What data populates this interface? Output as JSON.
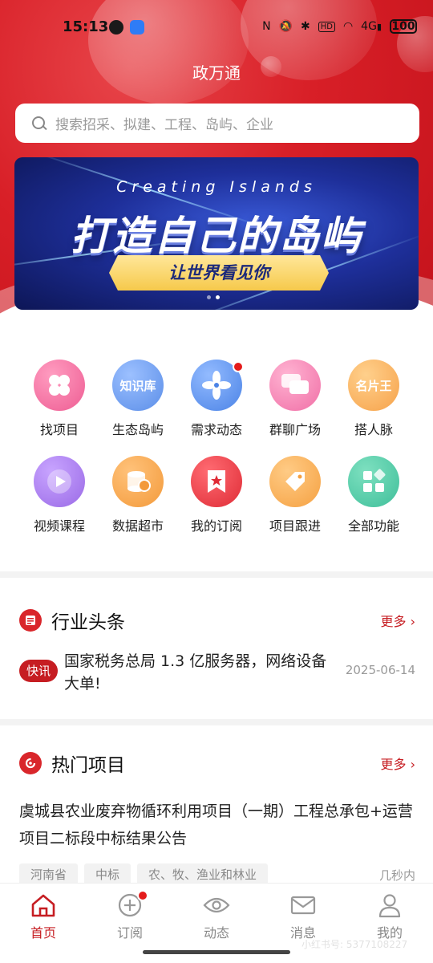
{
  "status_bar": {
    "time": "15:13",
    "network": "4G",
    "battery": "100",
    "icons": [
      "nfc-icon",
      "mute-icon",
      "bluetooth-icon",
      "hd-icon",
      "wifi-icon",
      "signal-icon"
    ]
  },
  "app": {
    "title": "政万通"
  },
  "search": {
    "placeholder": "搜索招采、拟建、工程、岛屿、企业"
  },
  "banner": {
    "subtitle": "Creating Islands",
    "headline": "打造自己的岛屿",
    "ribbon": "让世界看见你",
    "page_count": 2,
    "active_page": 2
  },
  "grid": [
    {
      "label": "找项目",
      "icon": "clover-icon",
      "color": "#ee5d93"
    },
    {
      "label": "生态岛屿",
      "icon": "knowledge-base-icon",
      "icon_text": "知识库",
      "color": "#5b8ee8"
    },
    {
      "label": "需求动态",
      "icon": "fan-icon",
      "color": "#4b83e6",
      "badge": true
    },
    {
      "label": "群聊广场",
      "icon": "chat-bubbles-icon",
      "color": "#f06fa6"
    },
    {
      "label": "搭人脉",
      "icon": "business-card-icon",
      "icon_text": "名片王",
      "color": "#f6a24a"
    },
    {
      "label": "视频课程",
      "icon": "play-icon",
      "color": "#9a6ae6"
    },
    {
      "label": "数据超市",
      "icon": "database-icon",
      "color": "#f39a3b"
    },
    {
      "label": "我的订阅",
      "icon": "bookmark-star-icon",
      "color": "#df2c36"
    },
    {
      "label": "项目跟进",
      "icon": "tag-icon",
      "color": "#f5a142"
    },
    {
      "label": "全部功能",
      "icon": "apps-grid-icon",
      "color": "#3fbf9a"
    }
  ],
  "news": {
    "title": "行业头条",
    "more": "更多",
    "tag": "快讯",
    "headline": "国家税务总局 1.3 亿服务器，网络设备大单!",
    "date": "2025-06-14"
  },
  "projects": {
    "title": "热门项目",
    "more": "更多",
    "item_title": "虞城县农业废弃物循环利用项目（一期）工程总承包+运营项目二标段中标结果公告",
    "tags": [
      "河南省",
      "中标",
      "农、牧、渔业和林业"
    ],
    "time": "几秒内"
  },
  "tabbar": [
    {
      "label": "首页",
      "icon": "home-icon",
      "active": true
    },
    {
      "label": "订阅",
      "icon": "plus-circle-icon",
      "badge": true
    },
    {
      "label": "动态",
      "icon": "eye-icon"
    },
    {
      "label": "消息",
      "icon": "mail-icon"
    },
    {
      "label": "我的",
      "icon": "user-icon"
    }
  ],
  "watermark": "小红书号: 5377108227",
  "colors": {
    "brand_red": "#d81f27",
    "accent_red": "#c61d22"
  }
}
